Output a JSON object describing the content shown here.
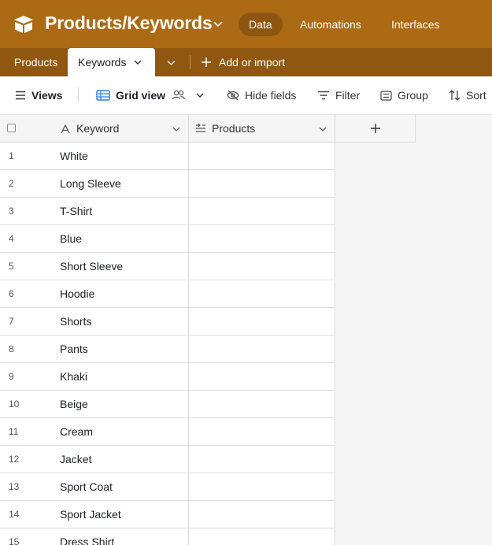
{
  "app": {
    "base_title": "Products/Keywords",
    "nav": [
      "Data",
      "Automations",
      "Interfaces"
    ],
    "colors": {
      "topbar": "#ad6a14",
      "tabbar": "#8f570f"
    }
  },
  "tabs": {
    "inactive": "Products",
    "active": "Keywords",
    "add_import": "Add or import"
  },
  "toolbar": {
    "views": "Views",
    "grid_view": "Grid view",
    "hide_fields": "Hide fields",
    "filter": "Filter",
    "group": "Group",
    "sort": "Sort"
  },
  "grid": {
    "columns": {
      "keyword": "Keyword",
      "products": "Products"
    },
    "rows": [
      {
        "num": "1",
        "keyword": "White"
      },
      {
        "num": "2",
        "keyword": "Long Sleeve"
      },
      {
        "num": "3",
        "keyword": "T-Shirt"
      },
      {
        "num": "4",
        "keyword": "Blue"
      },
      {
        "num": "5",
        "keyword": "Short Sleeve"
      },
      {
        "num": "6",
        "keyword": "Hoodie"
      },
      {
        "num": "7",
        "keyword": "Shorts"
      },
      {
        "num": "8",
        "keyword": "Pants"
      },
      {
        "num": "9",
        "keyword": "Khaki"
      },
      {
        "num": "10",
        "keyword": "Beige"
      },
      {
        "num": "11",
        "keyword": "Cream"
      },
      {
        "num": "12",
        "keyword": "Jacket"
      },
      {
        "num": "13",
        "keyword": "Sport Coat"
      },
      {
        "num": "14",
        "keyword": "Sport Jacket"
      },
      {
        "num": "15",
        "keyword": "Dress Shirt"
      }
    ]
  }
}
